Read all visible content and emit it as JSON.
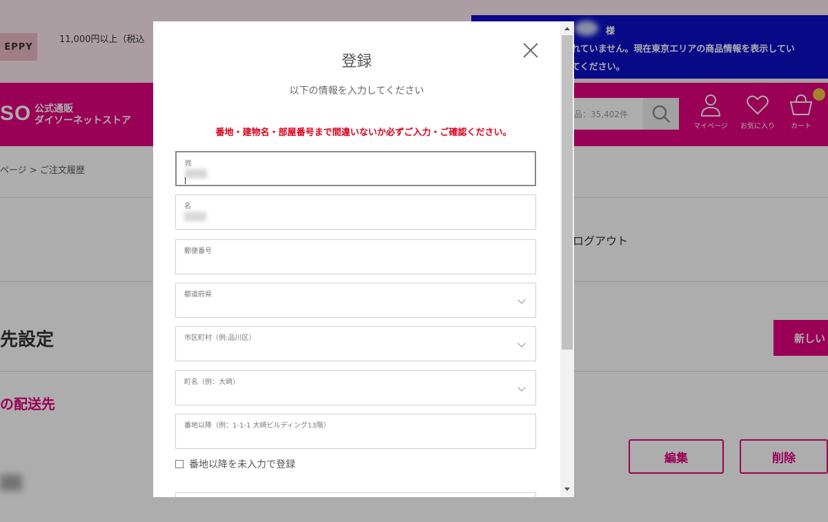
{
  "header": {
    "brand_chip": "EPPY",
    "shipping_note": "11,000円以上（税込",
    "area_notice": {
      "sama": "様",
      "line1": "れていません。現在東京エリアの商品情報を表示してい",
      "line2": "てください。"
    }
  },
  "navbar": {
    "logo_short": "SO",
    "logo_line1": "公式通販",
    "logo_line2": "ダイソーネットストア",
    "search_placeholder": "品：35,402件",
    "mypage_label": "マイページ",
    "favorites_label": "お気に入り",
    "cart_label": "カート"
  },
  "page": {
    "breadcrumb": "ページ > ご注文履歴",
    "logout": "ログアウト",
    "section_title": "先設定",
    "new_button": "新しい",
    "destination_title": "の配送先",
    "edit_button": "編集",
    "delete_button": "削除"
  },
  "modal": {
    "title": "登録",
    "subtitle": "以下の情報を入力してください",
    "warning": "番地・建物名・部屋番号まで間違いないか必ずご入力・ご確認ください。",
    "fields": [
      {
        "label": "姓"
      },
      {
        "label": "名"
      },
      {
        "label": "郵便番号"
      },
      {
        "label": "都道府県"
      },
      {
        "label": "市区町村（例:品川区）"
      },
      {
        "label": "町名（例：大崎）"
      },
      {
        "label": "番地以降（例：1-1-1 大崎ビルディング13階）"
      }
    ],
    "checkbox_label": "番地以降を未入力で登録"
  },
  "colors": {
    "brand": "#e4007f",
    "notice_bg": "#0c10c9",
    "warning": "#d6001c"
  }
}
